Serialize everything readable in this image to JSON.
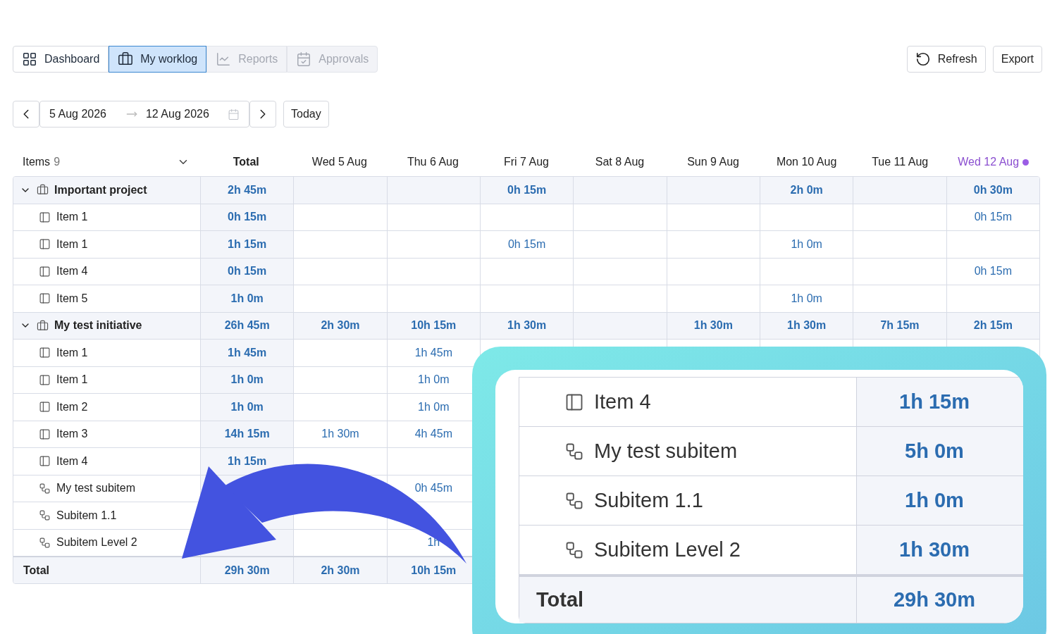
{
  "nav_tabs": [
    {
      "label": "Dashboard",
      "selected": false,
      "disabled": false
    },
    {
      "label": "My worklog",
      "selected": true,
      "disabled": false
    },
    {
      "label": "Reports",
      "selected": false,
      "disabled": true
    },
    {
      "label": "Approvals",
      "selected": false,
      "disabled": true
    }
  ],
  "actions": [
    {
      "label": "Refresh"
    },
    {
      "label": "Export"
    }
  ],
  "date_range": {
    "start": "5 Aug 2026",
    "end": "12 Aug 2026",
    "today_button": "Today"
  },
  "header": {
    "items_label": "Items",
    "items_count": "9",
    "total": "Total"
  },
  "days": [
    {
      "label": "Wed 5 Aug",
      "today": false
    },
    {
      "label": "Thu 6 Aug",
      "today": false
    },
    {
      "label": "Fri 7 Aug",
      "today": false
    },
    {
      "label": "Sat 8 Aug",
      "today": false
    },
    {
      "label": "Sun 9 Aug",
      "today": false
    },
    {
      "label": "Mon 10 Aug",
      "today": false
    },
    {
      "label": "Tue 11 Aug",
      "today": false
    },
    {
      "label": "Wed 12 Aug",
      "today": true
    }
  ],
  "groups": [
    {
      "name": "Important project",
      "expanded": true,
      "cells": [
        "2h 45m",
        null,
        null,
        "0h 15m",
        null,
        null,
        "2h 0m",
        null,
        "0h 30m"
      ],
      "children": [
        {
          "name": "Item 1",
          "kind": "item",
          "cells": [
            "0h 15m",
            null,
            null,
            null,
            null,
            null,
            null,
            null,
            "0h 15m"
          ]
        },
        {
          "name": "Item 1",
          "kind": "item",
          "cells": [
            "1h 15m",
            null,
            null,
            "0h 15m",
            null,
            null,
            "1h 0m",
            null,
            null
          ]
        },
        {
          "name": "Item 4",
          "kind": "item",
          "cells": [
            "0h 15m",
            null,
            null,
            null,
            null,
            null,
            null,
            null,
            "0h 15m"
          ]
        },
        {
          "name": "Item 5",
          "kind": "item",
          "cells": [
            "1h 0m",
            null,
            null,
            null,
            null,
            null,
            "1h 0m",
            null,
            null
          ]
        }
      ]
    },
    {
      "name": "My test initiative",
      "expanded": true,
      "cells": [
        "26h 45m",
        "2h 30m",
        "10h 15m",
        "1h 30m",
        null,
        "1h 30m",
        "1h 30m",
        "7h 15m",
        "2h 15m"
      ],
      "children": [
        {
          "name": "Item 1",
          "kind": "item",
          "cells": [
            "1h 45m",
            null,
            "1h 45m"
          ]
        },
        {
          "name": "Item 1",
          "kind": "item",
          "cells": [
            "1h 0m",
            null,
            "1h 0m"
          ]
        },
        {
          "name": "Item 2",
          "kind": "item",
          "cells": [
            "1h 0m",
            null,
            "1h 0m"
          ]
        },
        {
          "name": "Item 3",
          "kind": "item",
          "cells": [
            "14h 15m",
            "1h 30m",
            "4h 45m"
          ]
        },
        {
          "name": "Item 4",
          "kind": "item",
          "cells": [
            "1h 15m",
            null,
            null
          ]
        },
        {
          "name": "My test subitem",
          "kind": "subitem",
          "cells": [
            null,
            null,
            "0h 45m"
          ]
        },
        {
          "name": "Subitem 1.1",
          "kind": "subitem",
          "cells": [
            null,
            null,
            null
          ]
        },
        {
          "name": "Subitem Level 2",
          "kind": "subitem",
          "cells": [
            null,
            null,
            "1h"
          ]
        }
      ]
    }
  ],
  "footer": {
    "label": "Total",
    "cells": [
      "29h 30m",
      "2h 30m",
      "10h 15m"
    ]
  },
  "inset": {
    "rows": [
      {
        "name": "Item 4",
        "kind": "item",
        "total": "1h 15m"
      },
      {
        "name": "My test subitem",
        "kind": "subitem",
        "total": "5h 0m"
      },
      {
        "name": "Subitem 1.1",
        "kind": "subitem",
        "total": "1h 0m"
      },
      {
        "name": "Subitem Level 2",
        "kind": "subitem",
        "total": "1h 30m"
      }
    ],
    "footer": {
      "label": "Total",
      "total": "29h 30m"
    }
  }
}
